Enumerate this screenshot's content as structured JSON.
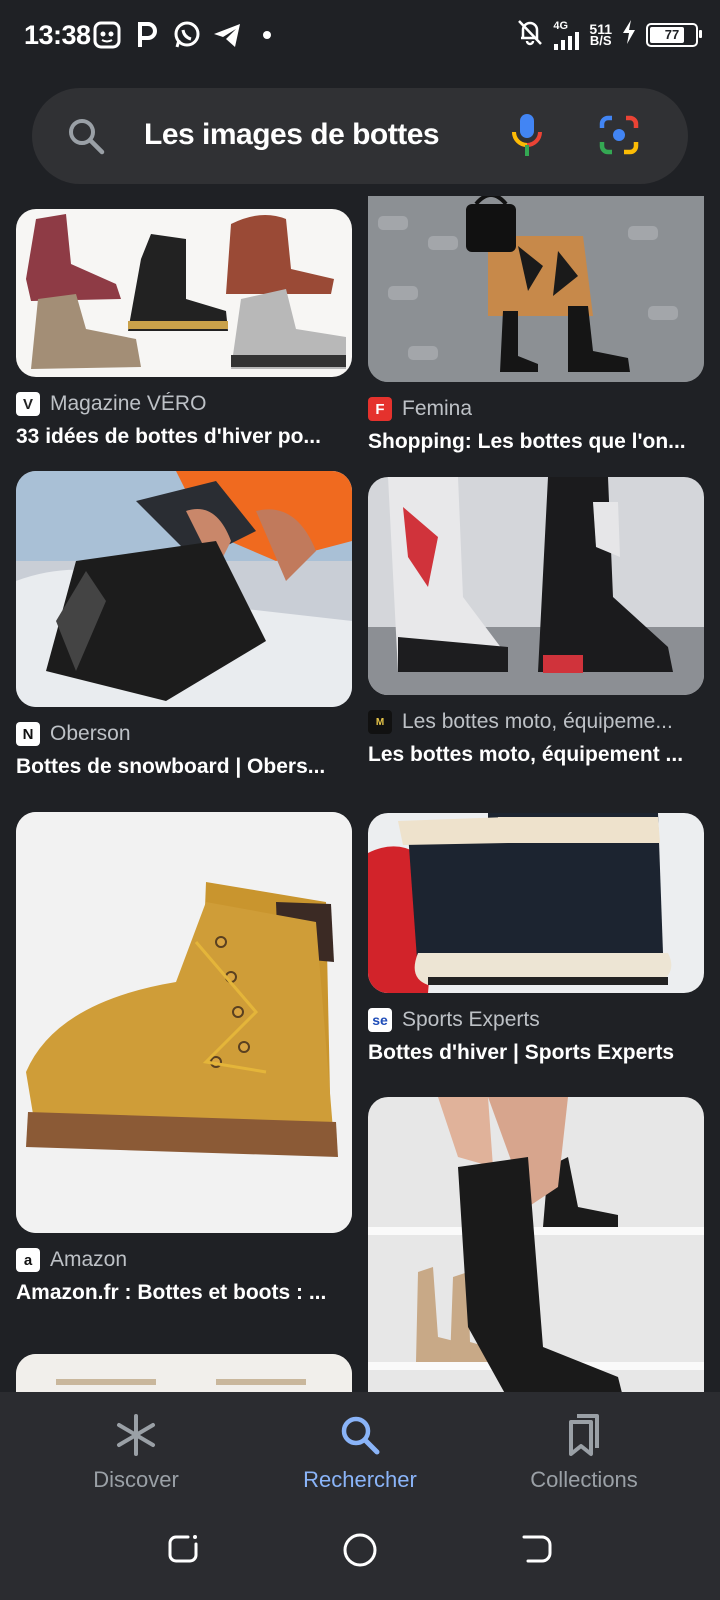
{
  "status_bar": {
    "time": "13:38",
    "network_type": "4G",
    "speed_value": "511",
    "speed_unit": "B/S",
    "battery": "77",
    "battery_level_percent": 77
  },
  "search": {
    "query": "Les images de bottes"
  },
  "results": [
    {
      "source": "Magazine VÉRO",
      "title": "33 idées de bottes d'hiver po...",
      "favicon": "V"
    },
    {
      "source": "Femina",
      "title": "Shopping: Les bottes que l'on...",
      "favicon": "F"
    },
    {
      "source": "Oberson",
      "title": "Bottes de snowboard | Obers...",
      "favicon": "N"
    },
    {
      "source": "Les bottes moto, équipeme...",
      "title": "Les bottes moto, équipement ...",
      "favicon": "M"
    },
    {
      "source": "Amazon",
      "title": "Amazon.fr : Bottes et boots : ...",
      "favicon": "a"
    },
    {
      "source": "Sports Experts",
      "title": "Bottes d'hiver | Sports Experts",
      "favicon": "se"
    }
  ],
  "bottom_nav": {
    "discover": "Discover",
    "search": "Rechercher",
    "collections": "Collections"
  },
  "colors": {
    "background": "#1f2125",
    "search_bar": "#303134",
    "nav_bar": "#2b2c30",
    "active": "#8ab4f8",
    "inactive": "#9aa0a6"
  }
}
